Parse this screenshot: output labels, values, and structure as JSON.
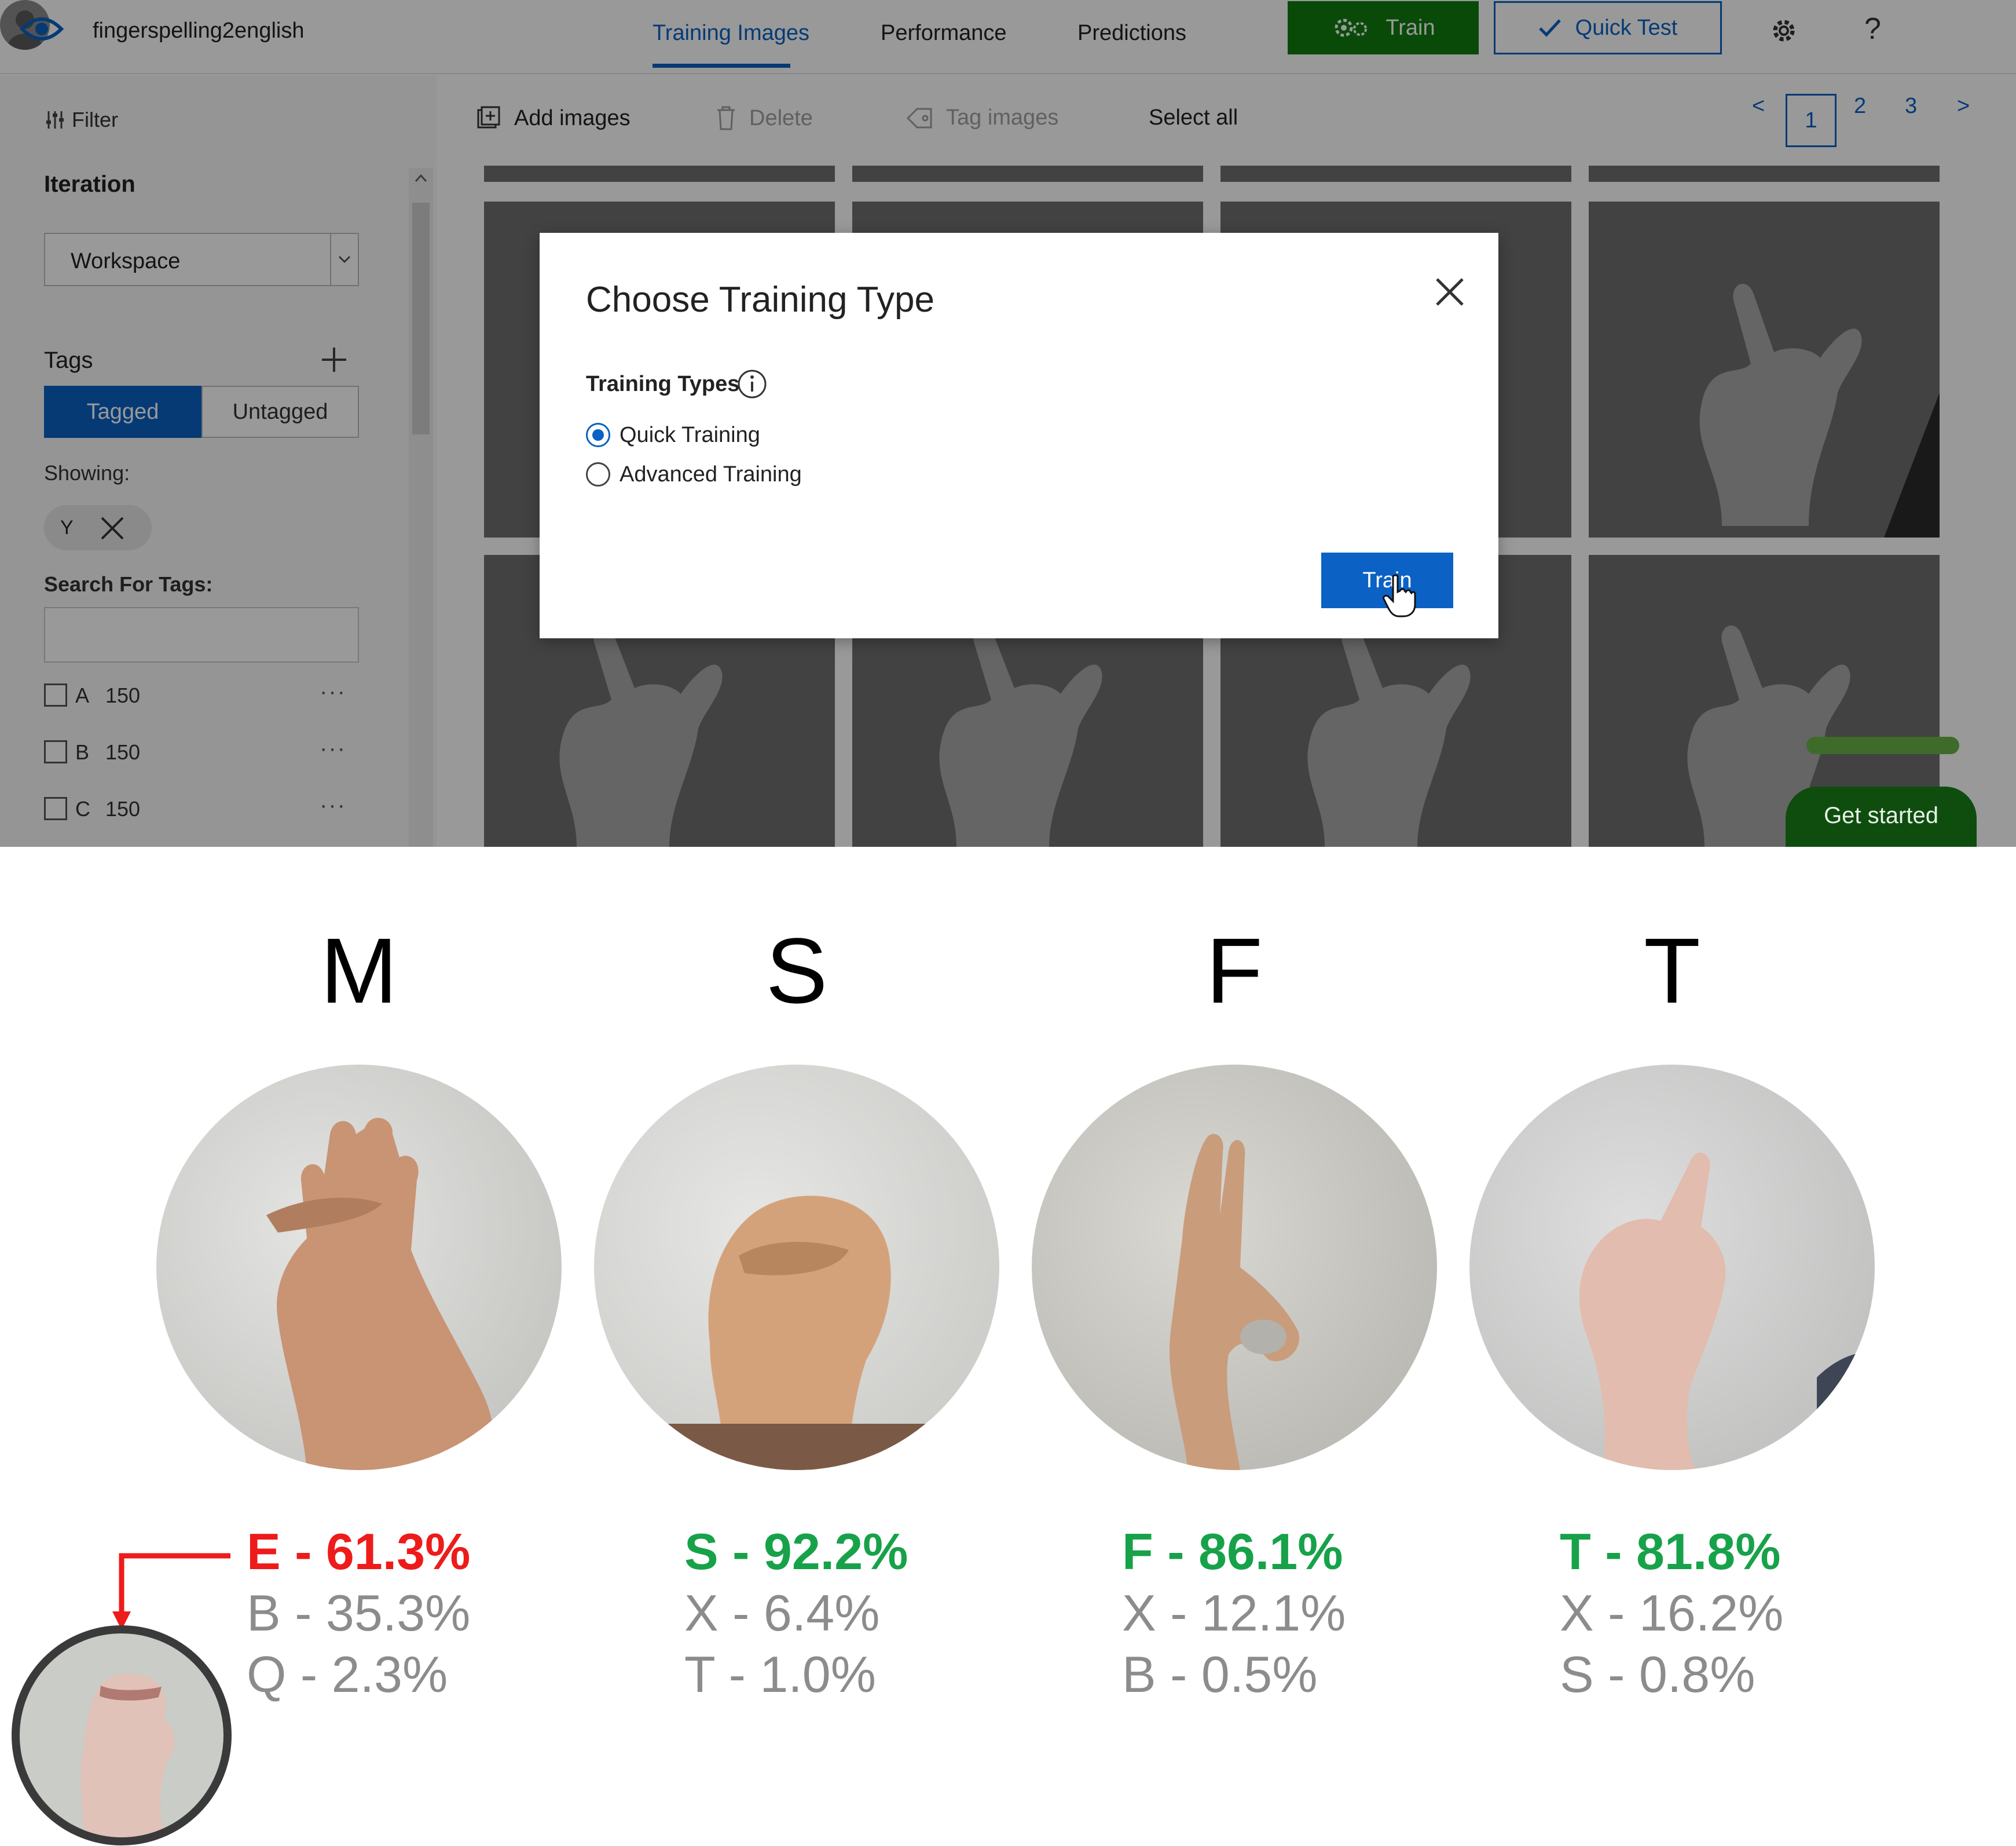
{
  "app": {
    "project_name": "fingerspelling2english",
    "tabs": [
      {
        "label": "Training Images",
        "active": true
      },
      {
        "label": "Performance",
        "active": false
      },
      {
        "label": "Predictions",
        "active": false
      }
    ],
    "train_button": "Train",
    "quick_test_button": "Quick Test",
    "help_glyph": "?",
    "colors": {
      "accent": "#0b62c4",
      "train_green": "#107c10",
      "overlay": "rgba(0,0,0,0.40)"
    }
  },
  "sidebar": {
    "filter_label": "Filter",
    "iteration_heading": "Iteration",
    "iteration_value": "Workspace",
    "tags_heading": "Tags",
    "tagged_label": "Tagged",
    "untagged_label": "Untagged",
    "showing_label": "Showing:",
    "chip_label": "Y",
    "search_label": "Search For Tags:",
    "search_value": "",
    "tags": [
      {
        "name": "A",
        "count": "150"
      },
      {
        "name": "B",
        "count": "150"
      },
      {
        "name": "C",
        "count": "150"
      }
    ],
    "more_glyph": "···"
  },
  "toolbar": {
    "add_images": "Add images",
    "delete": "Delete",
    "tag_images": "Tag images",
    "select_all": "Select all",
    "pager": {
      "prev": "<",
      "pages": [
        "1",
        "2",
        "3"
      ],
      "current": "1",
      "next": ">"
    }
  },
  "dialog": {
    "title": "Choose Training Type",
    "types_label": "Training Types",
    "options": [
      {
        "label": "Quick Training",
        "selected": true
      },
      {
        "label": "Advanced Training",
        "selected": false
      }
    ],
    "train_button": "Train"
  },
  "get_started": "Get started",
  "predictions": [
    {
      "letter": "M",
      "results": [
        "E - 61.3%",
        "B - 35.3%",
        "Q - 2.3%"
      ],
      "correct": false
    },
    {
      "letter": "S",
      "results": [
        "S - 92.2%",
        "X - 6.4%",
        "T - 1.0%"
      ],
      "correct": true
    },
    {
      "letter": "F",
      "results": [
        "F - 86.1%",
        "X - 12.1%",
        "B - 0.5%"
      ],
      "correct": true
    },
    {
      "letter": "T",
      "results": [
        "T - 81.8%",
        "X - 16.2%",
        "S - 0.8%"
      ],
      "correct": true
    }
  ],
  "colors": {
    "correct": "#17a24a",
    "wrong": "#ee1b1b",
    "secondary": "#8c8c8c"
  }
}
